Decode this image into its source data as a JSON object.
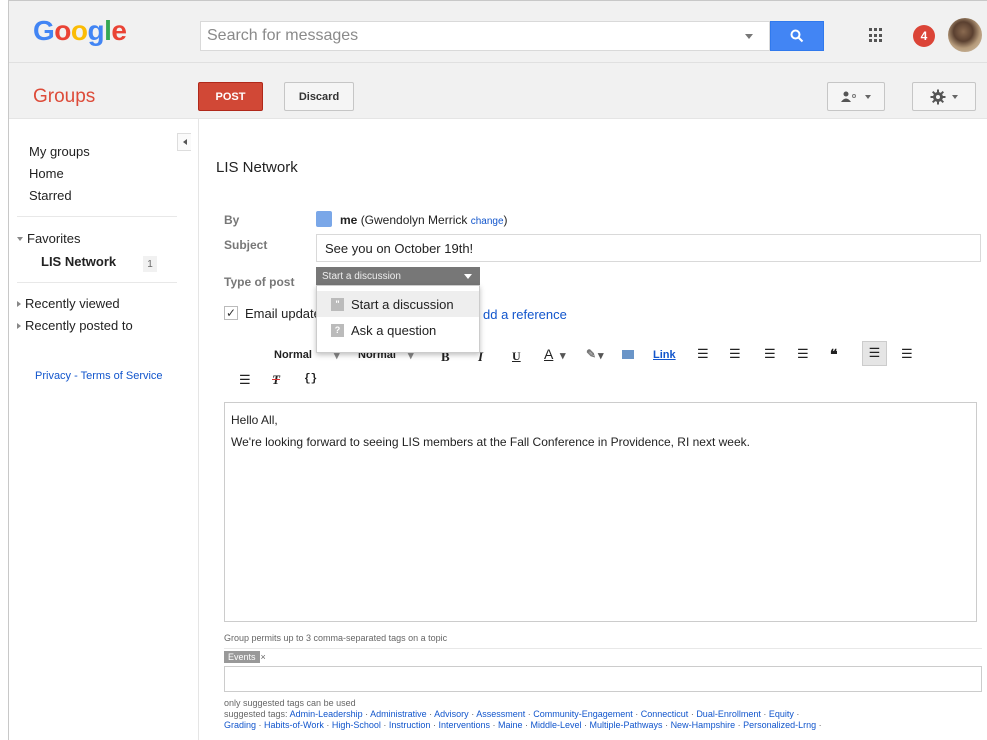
{
  "header": {
    "logo_letters": [
      "G",
      "o",
      "o",
      "g",
      "l",
      "e"
    ],
    "search_placeholder": "Search for messages",
    "notification_count": "4"
  },
  "subheader": {
    "title": "Groups",
    "post_label": "POST",
    "discard_label": "Discard"
  },
  "sidebar": {
    "items": [
      "My groups",
      "Home",
      "Starred"
    ],
    "favorites_label": "Favorites",
    "favorite_group": "LIS Network",
    "favorite_count": "1",
    "recently_viewed": "Recently viewed",
    "recently_posted": "Recently posted to",
    "privacy_link": "Privacy - Terms of Service"
  },
  "compose": {
    "group_name": "LIS Network",
    "by_label": "By",
    "author_me": "me",
    "author_name": "(Gwendolyn Merrick",
    "change_link": "change",
    "author_close": ")",
    "subject_label": "Subject",
    "subject_value": "See you on October 19th!",
    "type_label": "Type of post",
    "type_selected": "Start a discussion",
    "type_options": [
      "Start a discussion",
      "Ask a question"
    ],
    "email_updates_label": "Email update",
    "add_reference_link": "dd a reference",
    "body_lines": [
      "Hello All,",
      "We're looking forward to seeing LIS members at the Fall Conference in Providence, RI next week."
    ]
  },
  "toolbar": {
    "font_label": "Normal",
    "size_label": "Normal",
    "bold": "B",
    "italic": "I",
    "underline": "U",
    "text_color": "A",
    "link": "Link",
    "remove_format": "T",
    "code": "{}"
  },
  "tags": {
    "permits_note": "Group permits up to 3 comma-separated tags on a topic",
    "current_tag": "Events",
    "remove_x": "×",
    "only_suggested": "only suggested tags can be used",
    "suggested_prefix": "suggested tags: ",
    "suggested": [
      "Admin-Leadership",
      "Administrative",
      "Advisory",
      "Assessment",
      "Community-Engagement",
      "Connecticut",
      "Dual-Enrollment",
      "Equity",
      "Grading",
      "Habits-of-Work",
      "High-School",
      "Instruction",
      "Interventions",
      "Maine",
      "Middle-Level",
      "Multiple-Pathways",
      "New-Hampshire",
      "Personalized-Lrng"
    ]
  },
  "colors": {
    "accent_red": "#dd4b39",
    "post_button": "#d14836",
    "search_blue": "#4285f4",
    "link_blue": "#1155cc"
  },
  "icons": [
    "search-icon",
    "apps-grid-icon",
    "avatar",
    "members-icon",
    "gear-icon",
    "collapse-left-icon",
    "person-icon",
    "image-icon",
    "quote-icon"
  ]
}
